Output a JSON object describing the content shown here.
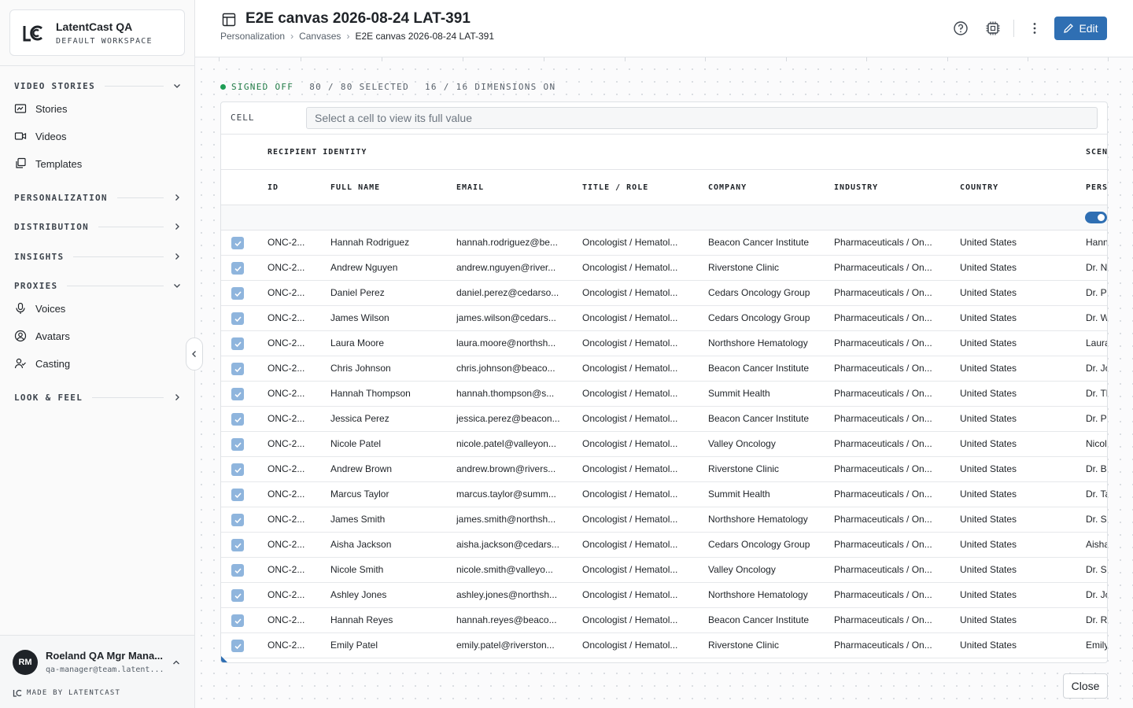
{
  "workspace": {
    "name": "LatentCast QA",
    "subtitle": "DEFAULT WORKSPACE"
  },
  "sidebar": {
    "sections": [
      {
        "label": "VIDEO STORIES",
        "expanded": true,
        "items": [
          {
            "label": "Stories",
            "icon": "stories-icon"
          },
          {
            "label": "Videos",
            "icon": "video-icon"
          },
          {
            "label": "Templates",
            "icon": "templates-icon"
          }
        ]
      },
      {
        "label": "PERSONALIZATION",
        "expanded": false
      },
      {
        "label": "DISTRIBUTION",
        "expanded": false
      },
      {
        "label": "INSIGHTS",
        "expanded": false
      },
      {
        "label": "PROXIES",
        "expanded": true,
        "items": [
          {
            "label": "Voices",
            "icon": "microphone-icon"
          },
          {
            "label": "Avatars",
            "icon": "avatar-icon"
          },
          {
            "label": "Casting",
            "icon": "casting-icon"
          }
        ]
      },
      {
        "label": "LOOK & FEEL",
        "expanded": false
      }
    ]
  },
  "user": {
    "initials": "RM",
    "name": "Roeland QA Mgr Mana...",
    "email": "qa-manager@team.latent...",
    "made_by": "MADE BY LATENTCAST"
  },
  "header": {
    "title": "E2E canvas 2026-08-24 LAT-391",
    "breadcrumbs": [
      "Personalization",
      "Canvases",
      "E2E canvas 2026-08-24 LAT-391"
    ],
    "edit_label": "Edit",
    "accent": "#2f6fb3"
  },
  "status": {
    "state": "SIGNED OFF",
    "selected": "80 / 80 SELECTED",
    "dimensions": "16 / 16 DIMENSIONS ON",
    "state_color": "#1f9d55"
  },
  "cell_bar": {
    "label": "CELL",
    "placeholder": "Select a cell to view its full value"
  },
  "table": {
    "groups": [
      "RECIPIENT IDENTITY",
      "SCEN"
    ],
    "columns": [
      "ID",
      "FULL NAME",
      "EMAIL",
      "TITLE / ROLE",
      "COMPANY",
      "INDUSTRY",
      "COUNTRY",
      "PERS"
    ],
    "rows": [
      [
        "ONC-2...",
        "Hannah Rodriguez",
        "hannah.rodriguez@be...",
        "Oncologist / Hematol...",
        "Beacon Cancer Institute",
        "Pharmaceuticals / On...",
        "United States",
        "Hann"
      ],
      [
        "ONC-2...",
        "Andrew Nguyen",
        "andrew.nguyen@river...",
        "Oncologist / Hematol...",
        "Riverstone Clinic",
        "Pharmaceuticals / On...",
        "United States",
        "Dr. N"
      ],
      [
        "ONC-2...",
        "Daniel Perez",
        "daniel.perez@cedarso...",
        "Oncologist / Hematol...",
        "Cedars Oncology Group",
        "Pharmaceuticals / On...",
        "United States",
        "Dr. Pe"
      ],
      [
        "ONC-2...",
        "James Wilson",
        "james.wilson@cedars...",
        "Oncologist / Hematol...",
        "Cedars Oncology Group",
        "Pharmaceuticals / On...",
        "United States",
        "Dr. W"
      ],
      [
        "ONC-2...",
        "Laura Moore",
        "laura.moore@northsh...",
        "Oncologist / Hematol...",
        "Northshore Hematology",
        "Pharmaceuticals / On...",
        "United States",
        "Laura"
      ],
      [
        "ONC-2...",
        "Chris Johnson",
        "chris.johnson@beaco...",
        "Oncologist / Hematol...",
        "Beacon Cancer Institute",
        "Pharmaceuticals / On...",
        "United States",
        "Dr. Jo"
      ],
      [
        "ONC-2...",
        "Hannah Thompson",
        "hannah.thompson@s...",
        "Oncologist / Hematol...",
        "Summit Health",
        "Pharmaceuticals / On...",
        "United States",
        "Dr. Th"
      ],
      [
        "ONC-2...",
        "Jessica Perez",
        "jessica.perez@beacon...",
        "Oncologist / Hematol...",
        "Beacon Cancer Institute",
        "Pharmaceuticals / On...",
        "United States",
        "Dr. Pe"
      ],
      [
        "ONC-2...",
        "Nicole Patel",
        "nicole.patel@valleyon...",
        "Oncologist / Hematol...",
        "Valley Oncology",
        "Pharmaceuticals / On...",
        "United States",
        "Nicol"
      ],
      [
        "ONC-2...",
        "Andrew Brown",
        "andrew.brown@rivers...",
        "Oncologist / Hematol...",
        "Riverstone Clinic",
        "Pharmaceuticals / On...",
        "United States",
        "Dr. Br"
      ],
      [
        "ONC-2...",
        "Marcus Taylor",
        "marcus.taylor@summ...",
        "Oncologist / Hematol...",
        "Summit Health",
        "Pharmaceuticals / On...",
        "United States",
        "Dr. Ta"
      ],
      [
        "ONC-2...",
        "James Smith",
        "james.smith@northsh...",
        "Oncologist / Hematol...",
        "Northshore Hematology",
        "Pharmaceuticals / On...",
        "United States",
        "Dr. Sr"
      ],
      [
        "ONC-2...",
        "Aisha Jackson",
        "aisha.jackson@cedars...",
        "Oncologist / Hematol...",
        "Cedars Oncology Group",
        "Pharmaceuticals / On...",
        "United States",
        "Aisha"
      ],
      [
        "ONC-2...",
        "Nicole Smith",
        "nicole.smith@valleyo...",
        "Oncologist / Hematol...",
        "Valley Oncology",
        "Pharmaceuticals / On...",
        "United States",
        "Dr. Sr"
      ],
      [
        "ONC-2...",
        "Ashley Jones",
        "ashley.jones@northsh...",
        "Oncologist / Hematol...",
        "Northshore Hematology",
        "Pharmaceuticals / On...",
        "United States",
        "Dr. Jo"
      ],
      [
        "ONC-2...",
        "Hannah Reyes",
        "hannah.reyes@beaco...",
        "Oncologist / Hematol...",
        "Beacon Cancer Institute",
        "Pharmaceuticals / On...",
        "United States",
        "Dr. Re"
      ],
      [
        "ONC-2...",
        "Emily Patel",
        "emily.patel@riverston...",
        "Oncologist / Hematol...",
        "Riverstone Clinic",
        "Pharmaceuticals / On...",
        "United States",
        "Emily"
      ]
    ]
  },
  "footer": {
    "close_label": "Close"
  }
}
